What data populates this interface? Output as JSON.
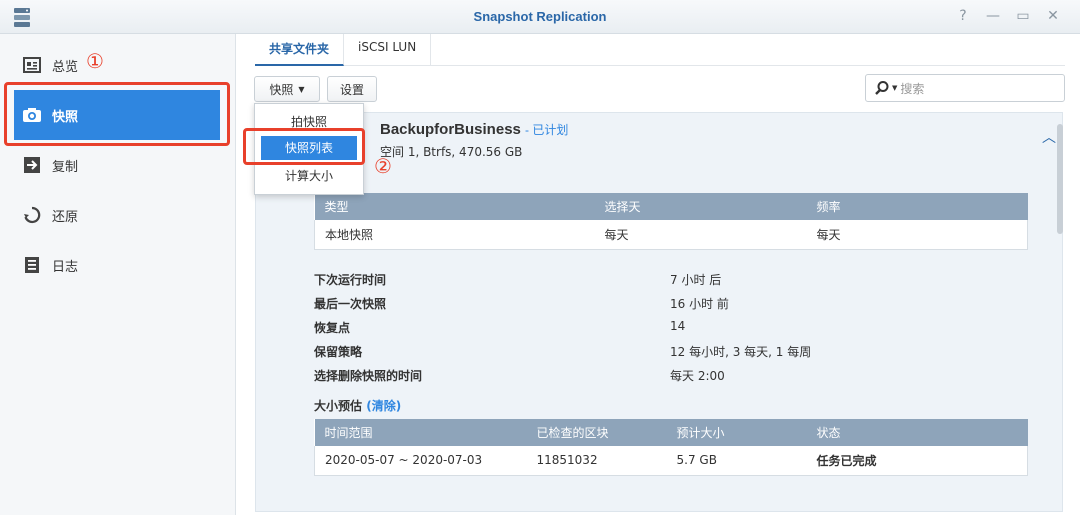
{
  "window": {
    "title": "Snapshot Replication"
  },
  "sidebar": {
    "items": [
      {
        "label": "总览",
        "icon": "overview-icon"
      },
      {
        "label": "快照",
        "icon": "camera-icon"
      },
      {
        "label": "复制",
        "icon": "replicate-icon"
      },
      {
        "label": "还原",
        "icon": "restore-icon"
      },
      {
        "label": "日志",
        "icon": "log-icon"
      }
    ],
    "active_index": 1
  },
  "annotations": {
    "step1": "①",
    "step2": "②"
  },
  "tabs": [
    {
      "label": "共享文件夹",
      "active": true
    },
    {
      "label": "iSCSI LUN",
      "active": false
    }
  ],
  "toolbar": {
    "snapshot_label": "快照",
    "settings_label": "设置",
    "search_placeholder": "搜索"
  },
  "dropdown": {
    "items": [
      {
        "label": "拍快照"
      },
      {
        "label": "快照列表"
      },
      {
        "label": "计算大小"
      }
    ],
    "selected_index": 1
  },
  "task": {
    "name": "BackupforBusiness",
    "status": "- 已计划",
    "subtitle": "空间 1, Btrfs, 470.56 GB"
  },
  "schedule_table": {
    "headers": [
      "类型",
      "选择天",
      "频率"
    ],
    "rows": [
      [
        "本地快照",
        "每天",
        "每天"
      ]
    ]
  },
  "details": [
    {
      "key": "下次运行时间",
      "value": "7 小时 后"
    },
    {
      "key": "最后一次快照",
      "value": "16 小时 前"
    },
    {
      "key": "恢复点",
      "value": "14"
    },
    {
      "key": "保留策略",
      "value": "12 每小时, 3 每天, 1 每周"
    },
    {
      "key": "选择删除快照的时间",
      "value": "每天 2:00"
    }
  ],
  "size_estimate": {
    "title": "大小预估",
    "clear_label": "(清除)",
    "headers": [
      "时间范围",
      "已检查的区块",
      "预计大小",
      "状态"
    ],
    "rows": [
      [
        "2020-05-07 ~ 2020-07-03",
        "11851032",
        "5.7 GB",
        "任务已完成"
      ]
    ]
  },
  "colors": {
    "accent": "#2f86e0",
    "highlight_border": "#e8402b",
    "table_header": "#8ea4ba"
  }
}
